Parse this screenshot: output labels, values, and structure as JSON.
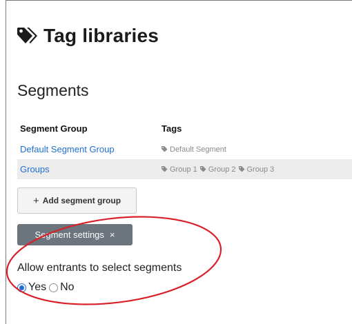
{
  "header": {
    "title": "Tag libraries",
    "icon": "tags-icon"
  },
  "section": {
    "title": "Segments"
  },
  "table": {
    "columns": [
      "Segment Group",
      "Tags"
    ],
    "rows": [
      {
        "group": "Default Segment Group",
        "tags": [
          "Default Segment"
        ]
      },
      {
        "group": "Groups",
        "tags": [
          "Group 1",
          "Group 2",
          "Group 3"
        ]
      }
    ]
  },
  "buttons": {
    "add_segment_group": "Add segment group",
    "segment_settings": "Segment settings",
    "close_symbol": "×"
  },
  "settings": {
    "allow_label": "Allow entrants to select segments",
    "options": [
      {
        "label": "Yes",
        "checked": true
      },
      {
        "label": "No",
        "checked": false
      }
    ]
  },
  "colors": {
    "link": "#1f6fd0",
    "settings_button": "#6c757d",
    "annotation": "#d9202a",
    "radio_checked": "#1e6fd9"
  }
}
